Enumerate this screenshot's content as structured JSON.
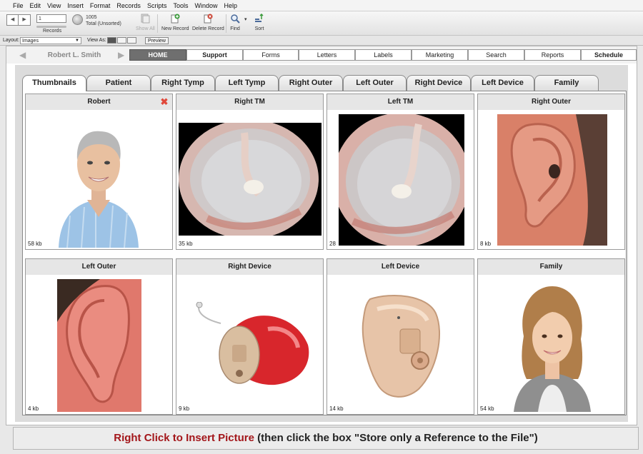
{
  "menu": [
    "File",
    "Edit",
    "View",
    "Insert",
    "Format",
    "Records",
    "Scripts",
    "Tools",
    "Window",
    "Help"
  ],
  "toolbar": {
    "record_value": "1",
    "records_label": "Records",
    "total_count": "1005",
    "total_label": "Total (Unsorted)",
    "show_all": "Show All",
    "new_record": "New Record",
    "delete_record": "Delete Record",
    "find": "Find",
    "sort": "Sort"
  },
  "layoutbar": {
    "layout_label": "Layout:",
    "layout_value": "Images",
    "view_as_label": "View As:",
    "preview_label": "Preview"
  },
  "topnav": {
    "patient_name": "Robert L. Smith",
    "tabs": [
      "HOME",
      "Support",
      "Forms",
      "Letters",
      "Labels",
      "Marketing",
      "Search",
      "Reports",
      "Schedule"
    ]
  },
  "subtabs": [
    "Thumbnails",
    "Patient",
    "Right Tymp",
    "Left Tymp",
    "Right Outer",
    "Left Outer",
    "Right Device",
    "Left Device",
    "Family"
  ],
  "cells": [
    {
      "title": "Robert",
      "size": "58 kb"
    },
    {
      "title": "Right TM",
      "size": "35 kb"
    },
    {
      "title": "Left TM",
      "size": "28"
    },
    {
      "title": "Right Outer",
      "size": "8 kb"
    },
    {
      "title": "Left Outer",
      "size": "4 kb"
    },
    {
      "title": "Right Device",
      "size": "9 kb"
    },
    {
      "title": "Left Device",
      "size": "14 kb"
    },
    {
      "title": "Family",
      "size": "54 kb"
    }
  ],
  "bottom": {
    "red_text": "Right Click to Insert Picture",
    "rest_text": " (then click the box \"Store only a Reference to the File\")"
  },
  "colors": {
    "accent_red": "#a3161a",
    "home_tab": "#6f6f6f",
    "delete_icon": "#e0483a"
  }
}
